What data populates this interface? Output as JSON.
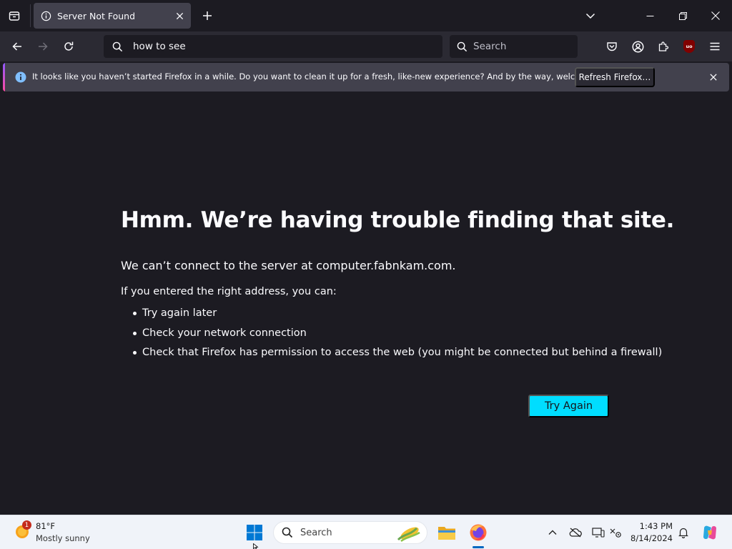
{
  "tab": {
    "title": "Server Not Found"
  },
  "nav": {
    "url": "how to see",
    "search_placeholder": "Search"
  },
  "notification": {
    "message": "It looks like you haven’t started Firefox in a while. Do you want to clean it up for a fresh, like-new experience? And by the way, welcome back!",
    "button_label": "Refresh Firefox…"
  },
  "error": {
    "title": "Hmm. We’re having trouble finding that site.",
    "description": "We can’t connect to the server at computer.fabnkam.com.",
    "hint": "If you entered the right address, you can:",
    "suggestions": [
      "Try again later",
      "Check your network connection",
      "Check that Firefox has permission to access the web (you might be connected but behind a firewall)"
    ],
    "button_label": "Try Again"
  },
  "taskbar": {
    "weather_temp": "81°F",
    "weather_condition": "Mostly sunny",
    "weather_badge": "1",
    "search_placeholder": "Search",
    "time": "1:43 PM",
    "date": "8/14/2024"
  },
  "colors": {
    "accent": "#00ddff",
    "page_background": "#1c1b22",
    "toolbar": "#2b2a33",
    "notification_bar": "#42414d"
  }
}
